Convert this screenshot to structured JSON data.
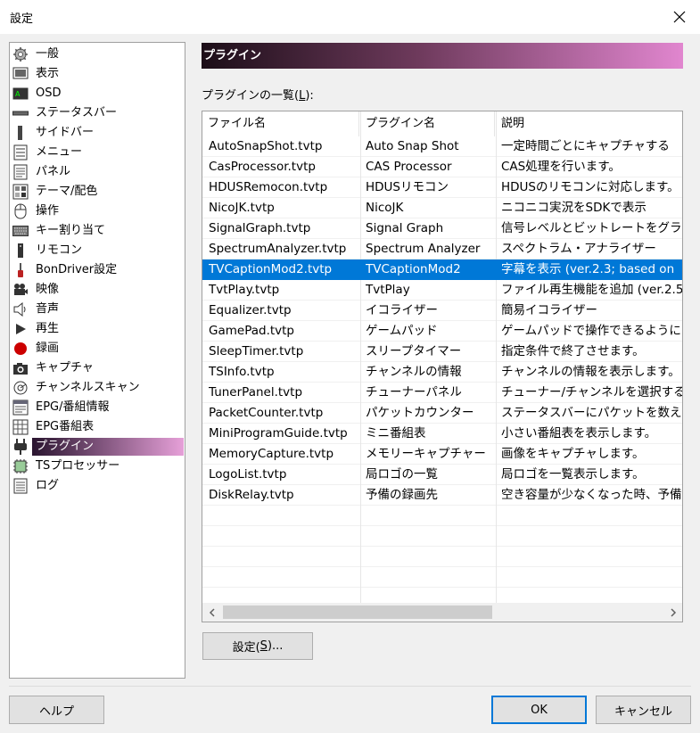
{
  "window": {
    "title": "設定"
  },
  "sidebar": {
    "items": [
      {
        "label": "一般",
        "icon": "gear-icon"
      },
      {
        "label": "表示",
        "icon": "display-icon"
      },
      {
        "label": "OSD",
        "icon": "osd-icon"
      },
      {
        "label": "ステータスバー",
        "icon": "statusbar-icon"
      },
      {
        "label": "サイドバー",
        "icon": "sidebar-icon"
      },
      {
        "label": "メニュー",
        "icon": "menu-icon"
      },
      {
        "label": "パネル",
        "icon": "panel-icon"
      },
      {
        "label": "テーマ/配色",
        "icon": "palette-icon"
      },
      {
        "label": "操作",
        "icon": "mouse-icon"
      },
      {
        "label": "キー割り当て",
        "icon": "keyboard-icon"
      },
      {
        "label": "リモコン",
        "icon": "remote-icon"
      },
      {
        "label": "BonDriver設定",
        "icon": "bondriver-icon"
      },
      {
        "label": "映像",
        "icon": "video-camera-icon"
      },
      {
        "label": "音声",
        "icon": "speaker-icon"
      },
      {
        "label": "再生",
        "icon": "play-icon"
      },
      {
        "label": "録画",
        "icon": "record-icon"
      },
      {
        "label": "キャプチャ",
        "icon": "camera-icon"
      },
      {
        "label": "チャンネルスキャン",
        "icon": "scan-icon"
      },
      {
        "label": "EPG/番組情報",
        "icon": "epg-info-icon"
      },
      {
        "label": "EPG番組表",
        "icon": "epg-table-icon"
      },
      {
        "label": "プラグイン",
        "icon": "plugin-icon"
      },
      {
        "label": "TSプロセッサー",
        "icon": "chip-icon"
      },
      {
        "label": "ログ",
        "icon": "log-icon"
      }
    ],
    "selected_index": 20
  },
  "main": {
    "header": "プラグイン",
    "list_caption_prefix": "プラグインの一覧(",
    "list_caption_key": "L",
    "list_caption_suffix": "):",
    "columns": [
      "ファイル名",
      "プラグイン名",
      "説明"
    ],
    "rows": [
      [
        "AutoSnapShot.tvtp",
        "Auto Snap Shot",
        "一定時間ごとにキャプチャする"
      ],
      [
        "CasProcessor.tvtp",
        "CAS Processor",
        "CAS処理を行います。"
      ],
      [
        "HDUSRemocon.tvtp",
        "HDUSリモコン",
        "HDUSのリモコンに対応します。"
      ],
      [
        "NicoJK.tvtp",
        "NicoJK",
        "ニコニコ実況をSDKで表示"
      ],
      [
        "SignalGraph.tvtp",
        "Signal Graph",
        "信号レベルとビットレートをグラフ表示"
      ],
      [
        "SpectrumAnalyzer.tvtp",
        "Spectrum Analyzer",
        "スペクトラム・アナライザー"
      ],
      [
        "TVCaptionMod2.tvtp",
        "TVCaptionMod2",
        "字幕を表示 (ver.2.3; based on"
      ],
      [
        "TvtPlay.tvtp",
        "TvtPlay",
        "ファイル再生機能を追加 (ver.2.5"
      ],
      [
        "Equalizer.tvtp",
        "イコライザー",
        "簡易イコライザー"
      ],
      [
        "GamePad.tvtp",
        "ゲームパッド",
        "ゲームパッドで操作できるようにします"
      ],
      [
        "SleepTimer.tvtp",
        "スリープタイマー",
        "指定条件で終了させます。"
      ],
      [
        "TSInfo.tvtp",
        "チャンネルの情報",
        "チャンネルの情報を表示します。"
      ],
      [
        "TunerPanel.tvtp",
        "チューナーパネル",
        "チューナー/チャンネルを選択するパネル"
      ],
      [
        "PacketCounter.tvtp",
        "パケットカウンター",
        "ステータスバーにパケットを数える項目"
      ],
      [
        "MiniProgramGuide.tvtp",
        "ミニ番組表",
        "小さい番組表を表示します。"
      ],
      [
        "MemoryCapture.tvtp",
        "メモリーキャプチャー",
        "画像をキャプチャします。"
      ],
      [
        "LogoList.tvtp",
        "局ロゴの一覧",
        "局ロゴを一覧表示します。"
      ],
      [
        "DiskRelay.tvtp",
        "予備の録画先",
        "空き容量が少なくなった時、予備の"
      ]
    ],
    "selected_row": 6,
    "settings_button_prefix": "設定(",
    "settings_button_key": "S",
    "settings_button_suffix": ")..."
  },
  "footer": {
    "help_label": "ヘルプ",
    "ok_label": "OK",
    "cancel_label": "キャンセル"
  }
}
